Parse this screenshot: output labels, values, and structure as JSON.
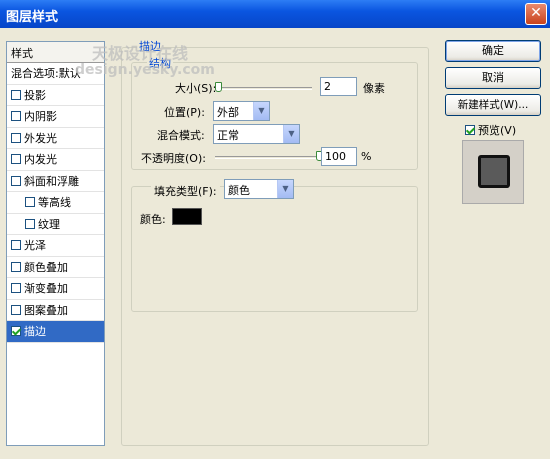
{
  "window": {
    "title": "图层样式",
    "close_glyph": "✕"
  },
  "styles_panel": {
    "header": "样式",
    "items": [
      {
        "label": "混合选项:默认",
        "checkbox": false,
        "sub": false,
        "checked": false
      },
      {
        "label": "投影",
        "checkbox": true,
        "sub": false,
        "checked": false
      },
      {
        "label": "内阴影",
        "checkbox": true,
        "sub": false,
        "checked": false
      },
      {
        "label": "外发光",
        "checkbox": true,
        "sub": false,
        "checked": false
      },
      {
        "label": "内发光",
        "checkbox": true,
        "sub": false,
        "checked": false
      },
      {
        "label": "斜面和浮雕",
        "checkbox": true,
        "sub": false,
        "checked": false
      },
      {
        "label": "等高线",
        "checkbox": true,
        "sub": true,
        "checked": false
      },
      {
        "label": "纹理",
        "checkbox": true,
        "sub": true,
        "checked": false
      },
      {
        "label": "光泽",
        "checkbox": true,
        "sub": false,
        "checked": false
      },
      {
        "label": "颜色叠加",
        "checkbox": true,
        "sub": false,
        "checked": false
      },
      {
        "label": "渐变叠加",
        "checkbox": true,
        "sub": false,
        "checked": false
      },
      {
        "label": "图案叠加",
        "checkbox": true,
        "sub": false,
        "checked": false
      },
      {
        "label": "描边",
        "checkbox": true,
        "sub": false,
        "checked": true,
        "selected": true
      }
    ]
  },
  "stroke": {
    "group_title": "描边",
    "structure_title": "结构",
    "size": {
      "label": "大小(S):",
      "value": "2",
      "unit": "像素",
      "level": 0.02
    },
    "position": {
      "label": "位置(P):",
      "value": "外部"
    },
    "blend_mode": {
      "label": "混合模式:",
      "value": "正常"
    },
    "opacity": {
      "label": "不透明度(O):",
      "value": "100",
      "unit": "%",
      "level": 1.0
    },
    "fill_type": {
      "label": "填充类型(F):",
      "value": "颜色"
    },
    "color": {
      "label": "颜色:",
      "swatch": "#000000"
    }
  },
  "buttons": {
    "ok": "确定",
    "cancel": "取消",
    "new_style": "新建样式(W)..."
  },
  "preview": {
    "label": "预览(V)",
    "checked": true
  },
  "watermark": {
    "line1": "天极设计在线",
    "line2": "design.yesky.com"
  }
}
